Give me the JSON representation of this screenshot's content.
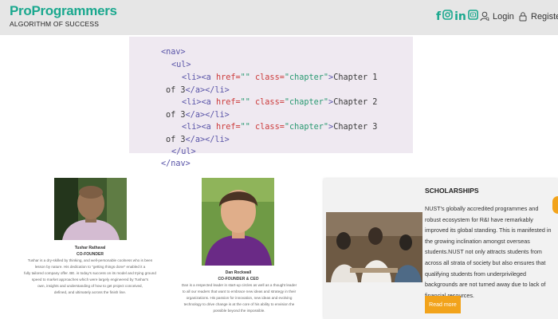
{
  "header": {
    "brand_name": "ProProgrammers",
    "tagline": "ALGORITHM OF SUCCESS",
    "social_icons": [
      "facebook-icon",
      "instagram-icon",
      "linkedin-icon",
      "youtube-icon"
    ],
    "login_label": "Login",
    "register_label": "Register",
    "accent_color": "#1aa88e"
  },
  "code": {
    "lines": [
      "<nav>",
      "  <ul>",
      "    <li><a href=\"\" class=\"chapter\">Chapter 1",
      "of 3</a></li>",
      "    <li><a href=\"\" class=\"chapter\">Chapter 2",
      "of 3</a></li>",
      "    <li><a href=\"\" class=\"chapter\">Chapter 3",
      "of 3</a></li>",
      "  </ul>",
      "</nav>"
    ]
  },
  "people": [
    {
      "name": "Tushar Rathaval",
      "role": "CO-FOUNDER",
      "bio": [
        "Tushar is a dry-skilled by thinking, and well-personable coolness who is been",
        "lesson by nature. His dedication to \"getting things done\" enabled it a",
        "fully tailored company offer. BE. is today's success on its model and trying ground",
        "speed to market approaches which were largely engineered by Tushar's",
        "own, insights and understanding of how to get project conceived,",
        "defined, and ultimately across the finish line."
      ]
    },
    {
      "name": "Dan Rockwall",
      "role": "CO-FOUNDER & CEO",
      "bio": [
        "Dan is a respected leader in start-up circles as well as a thought leader",
        "to all our readers that want to embrace new ideas and strategy in their",
        "organizations. His passion for innovation, new ideas and evolving",
        "technology to drive change is at the core of his ability to envision the",
        "possible beyond the impossible."
      ]
    }
  ],
  "scholarships": {
    "title": "SCHOLARSHIPS",
    "text": "NUST's globally accredited programmes and robust ecosystem for R&I have remarkably improved its global standing. This is manifested in the growing inclination amongst overseas students.NUST not only attracts students from across all strata of society but also ensures that qualifying students from underprivileged backgrounds are not turned away due to lack of financial resources.",
    "button_label": "Read more",
    "button_color": "#f2a31b"
  }
}
